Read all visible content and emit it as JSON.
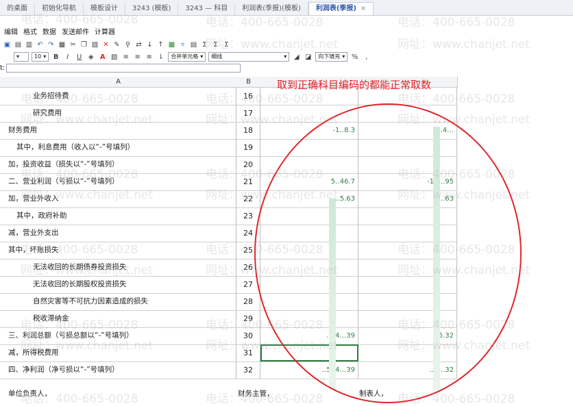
{
  "tabs": [
    {
      "label": "的桌面"
    },
    {
      "label": "初始化导航"
    },
    {
      "label": "模板设计"
    },
    {
      "label": "3243 (模板)"
    },
    {
      "label": "3243 — 科目"
    },
    {
      "label": "利润表(季报)(模板)"
    },
    {
      "label": "利润表(季报)",
      "close": "×"
    }
  ],
  "menu": [
    "编辑",
    "格式",
    "数据",
    "发送邮件",
    "计算器"
  ],
  "toolbar2": {
    "font_size": "10",
    "merge_select": "合并单元格",
    "line_select": "细线",
    "fill_select": "向下填充",
    "percent": "%"
  },
  "formula_label": "t:",
  "annotation": "取到正确科目编码的都能正常取数",
  "columns": {
    "a": "A",
    "b": "B"
  },
  "rows": [
    {
      "label": "业务招待费",
      "indent": 3,
      "num": "16",
      "c": "",
      "d": ""
    },
    {
      "label": "研究费用",
      "indent": 3,
      "num": "17",
      "c": "",
      "d": ""
    },
    {
      "label": "财务费用",
      "indent": 0,
      "num": "18",
      "c": "-1‥8.3",
      "d": "-‥4.‥"
    },
    {
      "label": "其中，利息费用（收入以“-”号填列）",
      "indent": 1,
      "num": "19",
      "c": "",
      "d": ""
    },
    {
      "label": "加，投资收益（损失以“-”号填列）",
      "indent": 0,
      "num": "20",
      "c": "",
      "d": ""
    },
    {
      "label": "二、营业利润（亏损以“-”号填列）",
      "indent": 0,
      "num": "21",
      "c": "5‥46.7",
      "d": "-13‥.95"
    },
    {
      "label": "加，营业外收入",
      "indent": 0,
      "num": "22",
      "c": "‥5.63",
      "d": "‥63"
    },
    {
      "label": "其中，政府补助",
      "indent": 1,
      "num": "23",
      "c": "",
      "d": ""
    },
    {
      "label": "减，营业外支出",
      "indent": 0,
      "num": "24",
      "c": "",
      "d": ""
    },
    {
      "label": "其中，坏账损失",
      "indent": 0,
      "num": "25",
      "c": "",
      "d": ""
    },
    {
      "label": "无法收回的长期债券投资损失",
      "indent": 3,
      "num": "26",
      "c": "",
      "d": ""
    },
    {
      "label": "无法收回的长期股权投资损失",
      "indent": 3,
      "num": "27",
      "c": "",
      "d": ""
    },
    {
      "label": "自然灾害等不可抗力因素造成的损失",
      "indent": 3,
      "num": "28",
      "c": "",
      "d": ""
    },
    {
      "label": "税收滞纳金",
      "indent": 3,
      "num": "29",
      "c": "",
      "d": ""
    },
    {
      "label": "三、利润总额（亏损总额以“-”号填列）",
      "indent": 0,
      "num": "30",
      "c": "‥04‥.39",
      "d": "‥5.32"
    },
    {
      "label": "减，所得税费用",
      "indent": 0,
      "num": "31",
      "c": "",
      "d": ""
    },
    {
      "label": "四、净利润（净亏损以“-”号填列）",
      "indent": 0,
      "num": "32",
      "c": "‥504‥.39",
      "d": "‥3‥.32"
    }
  ],
  "footer": {
    "left": "单位负责人，",
    "mid": "财务主管，",
    "right": "制表人，"
  },
  "watermark": {
    "phone": "电话：400-665-0028",
    "site": "网址：www.chanjet.net"
  },
  "colors": {
    "annotation": "#e0242a",
    "value_text": "#2e7d46",
    "active_tab": "#2b55a8"
  }
}
